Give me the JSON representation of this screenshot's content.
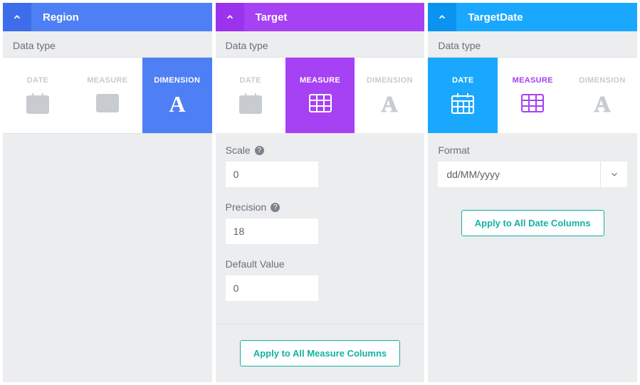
{
  "type_labels": {
    "date": "DATE",
    "measure": "MEASURE",
    "dimension": "DIMENSION"
  },
  "region": {
    "title": "Region",
    "data_type_label": "Data type",
    "selected": "dimension"
  },
  "target": {
    "title": "Target",
    "data_type_label": "Data type",
    "selected": "measure",
    "scale_label": "Scale",
    "scale_value": "0",
    "precision_label": "Precision",
    "precision_value": "18",
    "default_label": "Default Value",
    "default_value": "0",
    "apply_label": "Apply to All Measure Columns"
  },
  "target_date": {
    "title": "TargetDate",
    "data_type_label": "Data type",
    "selected": "date",
    "format_label": "Format",
    "format_value": "dd/MM/yyyy",
    "apply_label": "Apply to All Date Columns"
  }
}
